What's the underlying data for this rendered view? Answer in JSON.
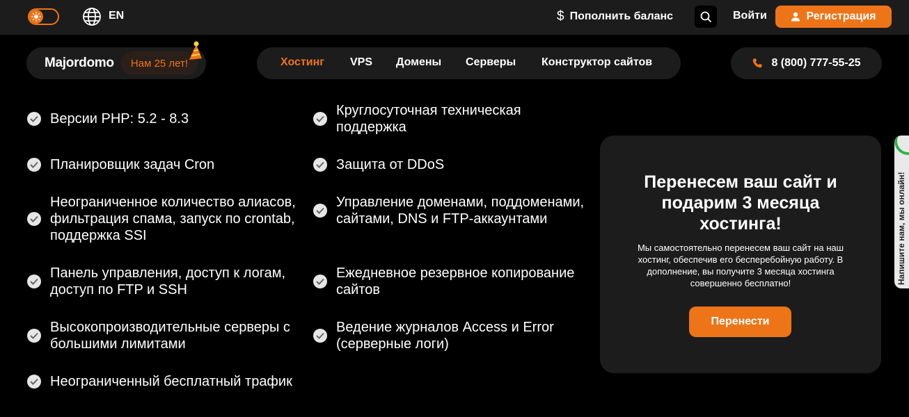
{
  "topbar": {
    "language": "EN",
    "topup_label": "Пополнить баланс",
    "topup_icon": "dollar-icon",
    "login_label": "Войти",
    "register_label": "Регистрация"
  },
  "brand": {
    "logo": "Majordomo",
    "anniversary_badge": "Нам 25 лет!"
  },
  "nav": {
    "items": [
      "Хостинг",
      "VPS",
      "Домены",
      "Серверы",
      "Конструктор сайтов"
    ],
    "active": "Хостинг"
  },
  "contact": {
    "phone": "8 (800) 777-55-25"
  },
  "features": {
    "left": [
      "Версии PHP: 5.2 - 8.3",
      "Планировщик задач Cron",
      "Неограниченное количество алиасов, фильтрация спама, запуск по crontab, поддержка SSI",
      "Панель управления, доступ к логам, доступ по FTP и SSH",
      "Высокопроизводительные серверы с большими лимитами",
      "Неограниченный бесплатный трафик"
    ],
    "right": [
      "Круглосуточная техническая поддержка",
      "Защита от DDoS",
      "Управление доменами, поддоменами, сайтами, DNS и FTP-аккаунтами",
      "Ежедневное резервное копирование сайтов",
      "Ведение журналов Access и Error (серверные логи)"
    ]
  },
  "promo": {
    "title": "Перенесем ваш сайт и подарим 3 месяца хостинга!",
    "description": "Мы самостоятельно перенесем ваш сайт на наш хостинг, обеспечив его бесперебойную работу. В дополнение, вы получите 3 месяца хостинга совершенно бесплатно!",
    "button_label": "Перенести"
  },
  "side_tab": {
    "label": "Напишите нам, мы онлайн!"
  },
  "colors": {
    "accent": "#ee7418",
    "background": "#000000",
    "surface": "#1c1c1c"
  }
}
